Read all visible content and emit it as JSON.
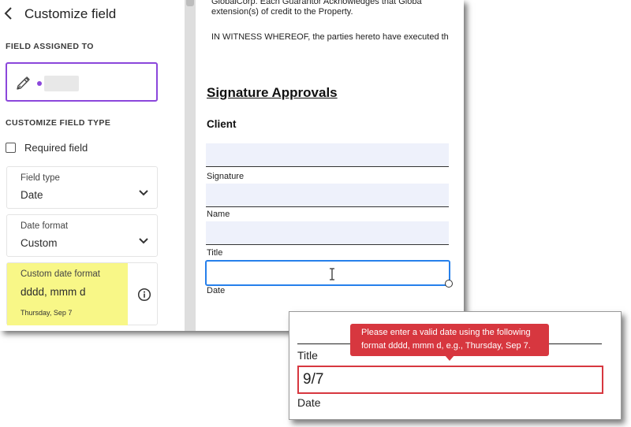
{
  "panel": {
    "title": "Customize field",
    "field_assigned_to_label": "FIELD ASSIGNED TO",
    "customize_type_label": "CUSTOMIZE FIELD TYPE",
    "required_field_label": "Required field",
    "field_type": {
      "label": "Field type",
      "value": "Date"
    },
    "date_format": {
      "label": "Date format",
      "value": "Custom"
    },
    "custom_date_format": {
      "label": "Custom date format",
      "value": "dddd, mmm d",
      "preview": "Thursday, Sep 7"
    },
    "highlight_color": "#f8f787",
    "accent_color": "#8b47db"
  },
  "document": {
    "lines": [
      "GlobalCorp.  Each  Guarantor  Acknowledges  that  Globa",
      "extension(s) of credit to the Property.",
      "IN WITNESS WHEREOF, the parties hereto have executed th"
    ],
    "heading": "Signature Approvals",
    "subheading": "Client",
    "fields": [
      {
        "caption": "Signature"
      },
      {
        "caption": "Name"
      },
      {
        "caption": "Title"
      },
      {
        "caption": "Date"
      }
    ]
  },
  "inset": {
    "title_label": "Title",
    "date_value": "9/7",
    "date_label": "Date",
    "error_line1": "Please enter a valid date using the following",
    "error_line2": "format dddd, mmm d, e.g., Thursday, Sep 7.",
    "error_color": "#d7373f"
  },
  "icons": [
    "chevron-left-icon",
    "pen-icon",
    "chevron-down-icon",
    "info-icon",
    "text-cursor-icon"
  ]
}
